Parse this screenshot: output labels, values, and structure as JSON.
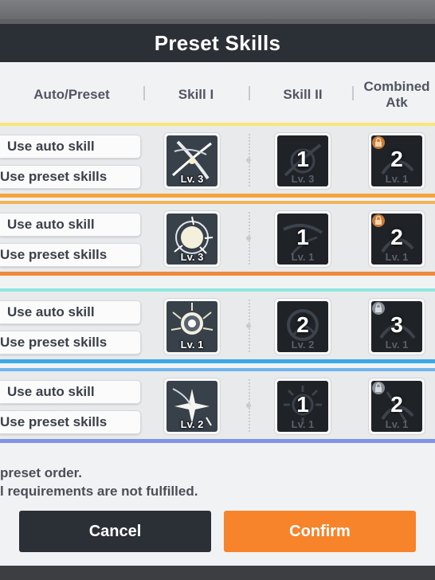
{
  "title": "Preset Skills",
  "headers": {
    "auto_preset": "Auto/Preset",
    "skill1": "Skill I",
    "skill2": "Skill II",
    "combined": "Combined Atk"
  },
  "rows": [
    {
      "accent_top": "#f6e97a",
      "accent_bottom": "#f4a43a",
      "auto_label": "Use auto skill",
      "preset_label": "Use preset skills",
      "skill1_level": "Lv. 3",
      "skill2_order": "1",
      "skill2_level": "Lv. 3",
      "combined_order": "2",
      "combined_level": "Lv. 1",
      "skill1_icon": "slash-icon",
      "combined_lock": "orange"
    },
    {
      "accent_top": "#f0b45a",
      "accent_bottom": "#ef8a3d",
      "auto_label": "Use auto skill",
      "preset_label": "Use preset skills",
      "skill1_level": "Lv. 3",
      "skill2_order": "1",
      "skill2_level": "Lv. 1",
      "combined_order": "2",
      "combined_level": "Lv. 1",
      "skill1_icon": "burst-icon",
      "combined_lock": "orange"
    },
    {
      "accent_top": "#8fe6e0",
      "accent_bottom": "#3aa8e6",
      "auto_label": "Use auto skill",
      "preset_label": "Use preset skills",
      "skill1_level": "Lv. 1",
      "skill2_order": "2",
      "skill2_level": "Lv. 2",
      "combined_order": "3",
      "combined_level": "Lv. 1",
      "skill1_icon": "shield-burst-icon",
      "combined_lock": "grey"
    },
    {
      "accent_top": "#6fb5ee",
      "accent_bottom": "#7f94e6",
      "auto_label": "Use auto skill",
      "preset_label": "Use preset skills",
      "skill1_level": "Lv. 2",
      "skill2_order": "1",
      "skill2_level": "Lv. 1",
      "combined_order": "2",
      "combined_level": "Lv. 1",
      "skill1_icon": "sparkle-icon",
      "combined_lock": "grey"
    }
  ],
  "footer": {
    "line1": "preset order.",
    "line2": "l requirements are not fulfilled."
  },
  "buttons": {
    "cancel": "Cancel",
    "confirm": "Confirm"
  },
  "colors": {
    "title_bar": "#2b2f36",
    "confirm": "#f7832b",
    "cancel": "#2b2f36"
  }
}
